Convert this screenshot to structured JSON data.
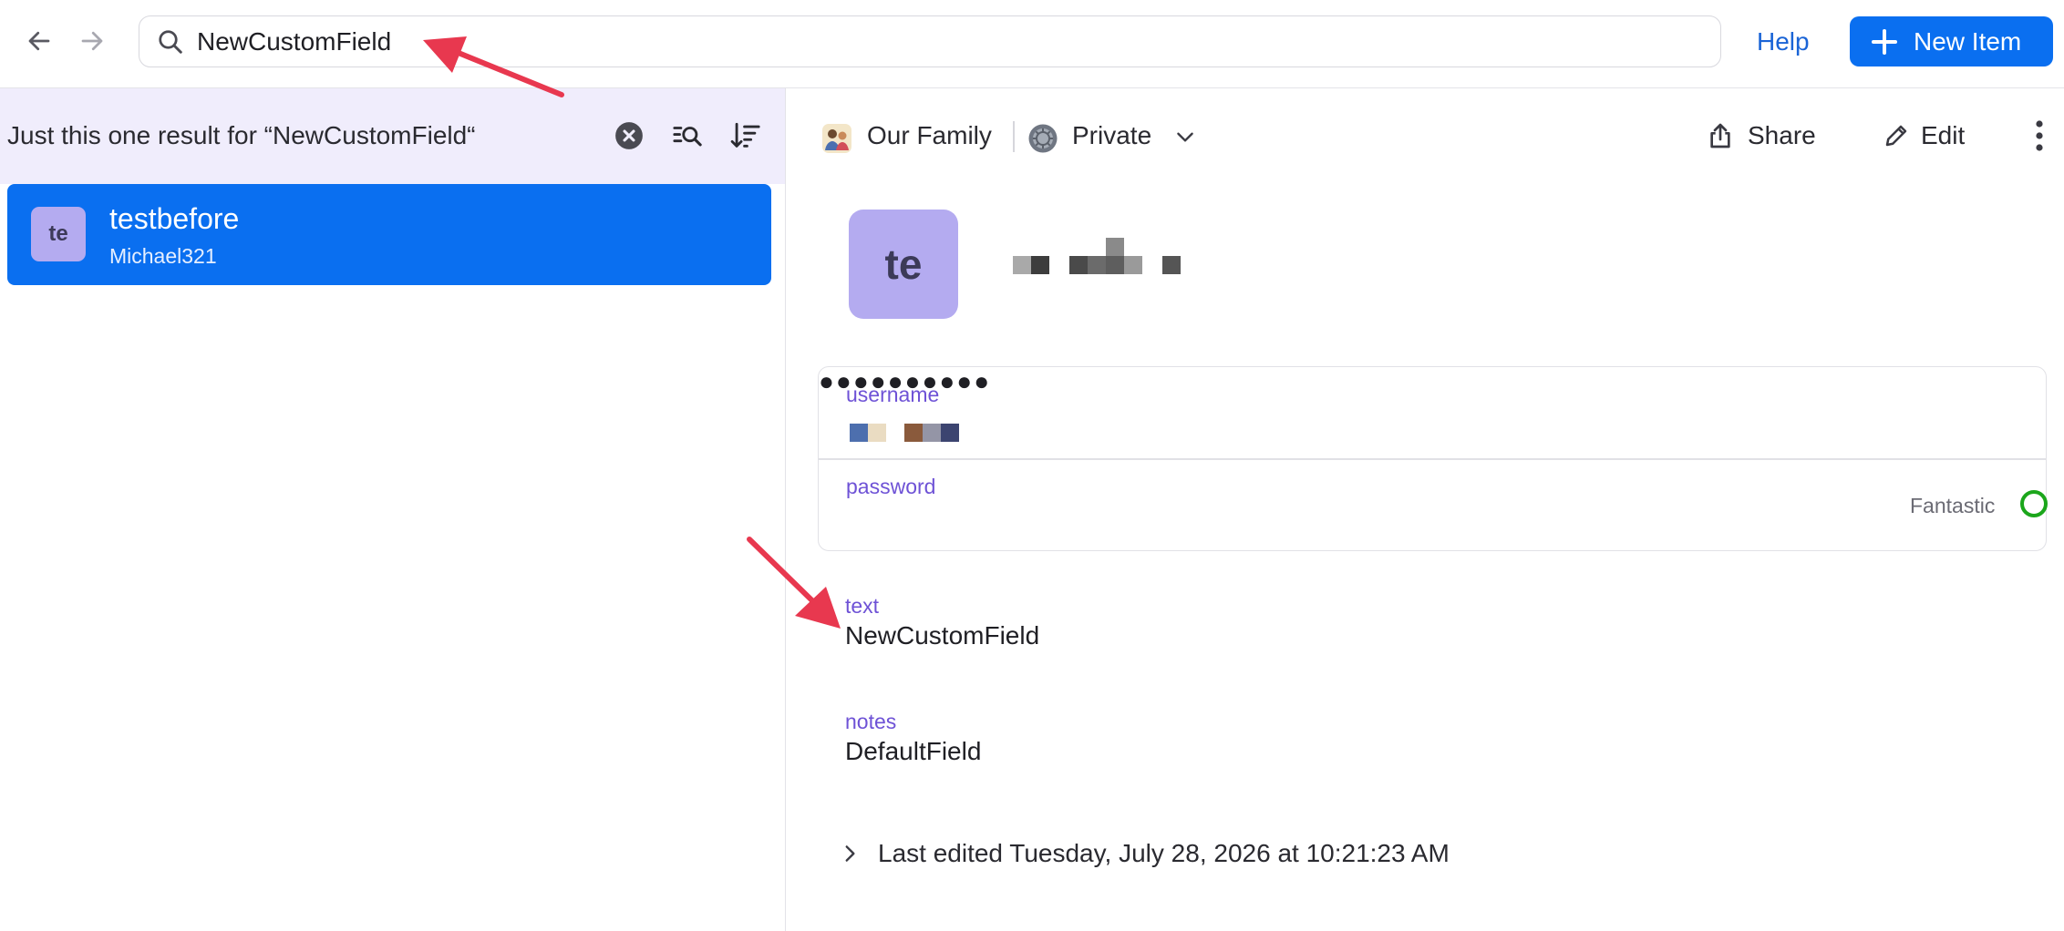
{
  "topbar": {
    "search_value": "NewCustomField",
    "help_label": "Help",
    "new_item_label": "New Item"
  },
  "results": {
    "summary": "Just this one result for “NewCustomField“",
    "items": [
      {
        "initials": "te",
        "title": "testbefore",
        "subtitle": "Michael321"
      }
    ]
  },
  "detail": {
    "vaults": [
      {
        "label": "Our Family"
      },
      {
        "label": "Private"
      }
    ],
    "share_label": "Share",
    "edit_label": "Edit",
    "avatar_initials": "te",
    "fields": {
      "username_label": "username",
      "password_label": "password",
      "password_mask": "●●●●●●●●●●",
      "strength_label": "Fantastic",
      "text_label": "text",
      "text_value": "NewCustomField",
      "notes_label": "notes",
      "notes_value": "DefaultField"
    },
    "last_edited": "Last edited Tuesday, July 28, 2026 at 10:21:23 AM"
  },
  "icons": {
    "back": "arrow-left-icon",
    "forward": "arrow-right-icon",
    "search": "search-icon",
    "plus": "plus-icon",
    "clear": "clear-circle-icon",
    "filter": "search-filter-icon",
    "sort": "sort-icon",
    "family": "family-vault-icon",
    "private": "private-vault-icon",
    "chevron": "chevron-down-icon",
    "share": "share-icon",
    "edit": "pencil-icon",
    "more": "more-vertical-icon",
    "expand": "chevron-right-icon"
  },
  "colors": {
    "accent": "#0a6ff0",
    "selection_bg": "#0a6ff0",
    "results_header_bg": "#f0edfc",
    "avatar_bg": "#b4abf0",
    "field_label": "#6e52d6",
    "strength_ring": "#1ba61b",
    "annotation_arrow": "#e8384f"
  }
}
